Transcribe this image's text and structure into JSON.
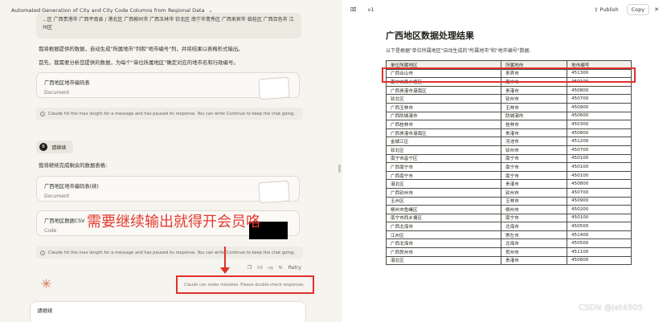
{
  "chat": {
    "title": "Automated Generation of City and City Code Columns from Regional Data",
    "prev_text": "...区 广西贵港市 广西平南县 / 港北区 广西柳州市 广西玉林市 钦北区 南宁市青秀区 广西来宾市 临桂区 广西百色市 江州区",
    "para1": "我将根据提供的数据，自动生成\"所属地市\"列和\"地市编号\"列，并将结果以表格形式输出。",
    "para2": "首先，我需要分析您提供的数据，为每个\"单位所属地区\"确定对应的地市名和行政编号。",
    "artifact1": {
      "title": "广西地区地市编码表",
      "subtitle": "Document"
    },
    "notice": "Claude hit the max length for a message and has paused its response. You can write Continue to keep the chat going.",
    "user_avatar": "B",
    "user_msg": "请继续",
    "para3": "我将继续完成剩余的数据表格:",
    "artifact2": {
      "title": "广西地区地市编码表(续)",
      "subtitle": "Document"
    },
    "artifact3": {
      "title": "广西地区数据CSV",
      "subtitle": "Code"
    },
    "overlay": "需要继续输出就得开会员咯",
    "retry": "Retry",
    "disclaimer": "Claude can make mistakes. Please double-check responses.",
    "input_value": "请继续"
  },
  "artifact_panel": {
    "version": "v1",
    "publish": "Publish",
    "copy": "Copy",
    "doc_title": "广西地区数据处理结果",
    "doc_subtitle": "以下是根据\"单位所属地区\"自动生成的\"所属地市\"和\"地市编号\"数据:",
    "watermark": "CSDN @jet4505"
  },
  "table": {
    "headers": [
      "单位所属地区",
      "所属地市",
      "地市编号"
    ],
    "rows": [
      [
        "广西合山市",
        "来宾市",
        "451300"
      ],
      [
        "南宁市西乡塘区",
        "南宁市",
        "450100"
      ],
      [
        "广西贵港市港南区",
        "贵港市",
        "450800"
      ],
      [
        "钦北区",
        "钦州市",
        "450700"
      ],
      [
        "广西玉林市",
        "玉林市",
        "450900"
      ],
      [
        "广西防城港市",
        "防城港市",
        "450600"
      ],
      [
        "广西桂林市",
        "桂林市",
        "450300"
      ],
      [
        "广西贵港市港南区",
        "贵港市",
        "450800"
      ],
      [
        "金城江区",
        "河池市",
        "451200"
      ],
      [
        "钦北区",
        "钦州市",
        "450700"
      ],
      [
        "南宁市邕宁区",
        "南宁市",
        "450100"
      ],
      [
        "广西南宁市",
        "南宁市",
        "450100"
      ],
      [
        "广西南宁市",
        "南宁市",
        "450100"
      ],
      [
        "港北区",
        "贵港市",
        "450800"
      ],
      [
        "广西钦州市",
        "钦州市",
        "450700"
      ],
      [
        "玉州区",
        "玉林市",
        "450900"
      ],
      [
        "柳州市鱼峰区",
        "柳州市",
        "450200"
      ],
      [
        "南宁市西乡塘区",
        "南宁市",
        "450100"
      ],
      [
        "广西北海市",
        "北海市",
        "450500"
      ],
      [
        "江州区",
        "崇左市",
        "451400"
      ],
      [
        "广西北海市",
        "北海市",
        "450500"
      ],
      [
        "广西贺州市",
        "贺州市",
        "451100"
      ],
      [
        "港北区",
        "贵港市",
        "450800"
      ]
    ]
  }
}
